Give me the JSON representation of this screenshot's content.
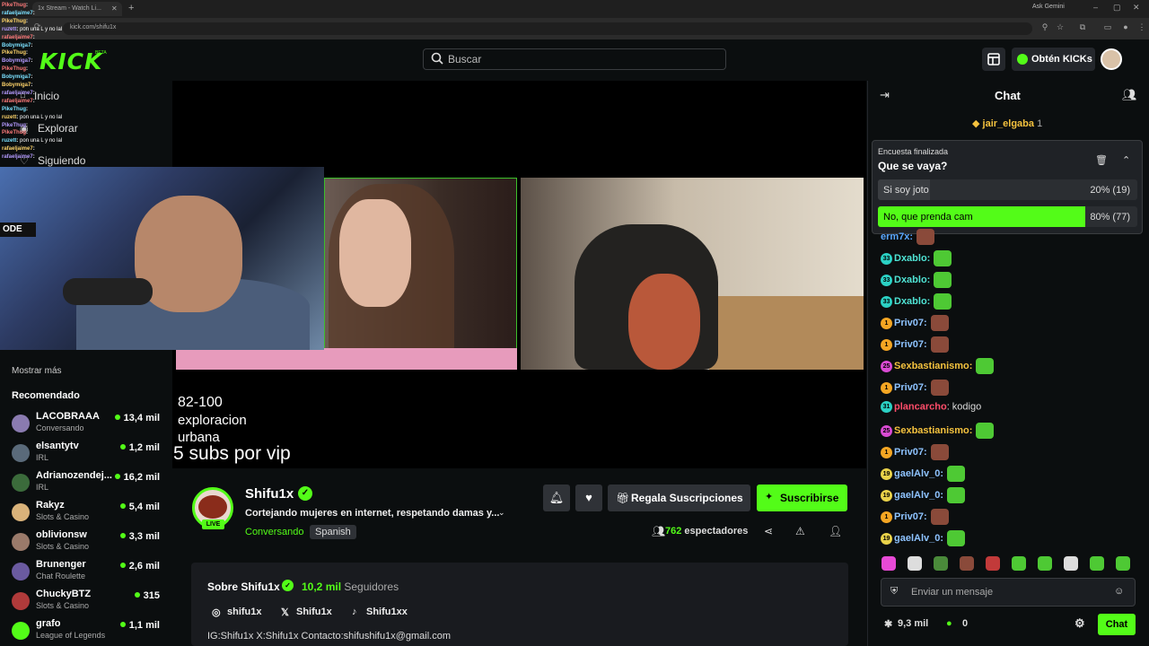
{
  "browser": {
    "tab_title": "1x Stream - Watch Li...",
    "url": "kick.com/shifu1x",
    "gemini_label": "Ask Gemini"
  },
  "header": {
    "logo": "KICK",
    "logo_badge": "BETA",
    "search_placeholder": "Buscar",
    "kicks_label": "Obtén KICKs"
  },
  "sidebar": {
    "nav": [
      {
        "label": "Inicio",
        "icon": "home-icon"
      },
      {
        "label": "Explorar",
        "icon": "compass-icon"
      },
      {
        "label": "Siguiendo",
        "icon": "heart-icon"
      }
    ],
    "show_more": "Mostrar más",
    "recommended_title": "Recomendado",
    "recommended": [
      {
        "name": "LACOBRAAA",
        "category": "Conversando",
        "viewers": "13,4 mil",
        "color": "#8a7bb0"
      },
      {
        "name": "elsantytv",
        "category": "IRL",
        "viewers": "1,2 mil",
        "color": "#5a6a7a"
      },
      {
        "name": "Adrianozendej...",
        "category": "IRL",
        "viewers": "16,2 mil",
        "color": "#3b6b3b"
      },
      {
        "name": "Rakyz",
        "category": "Slots & Casino",
        "viewers": "5,4 mil",
        "color": "#d9b27a"
      },
      {
        "name": "oblivionsw",
        "category": "Slots & Casino",
        "viewers": "3,3 mil",
        "color": "#9a7a6a"
      },
      {
        "name": "Brunenger",
        "category": "Chat Roulette",
        "viewers": "2,6 mil",
        "color": "#6a5aa0"
      },
      {
        "name": "ChuckyBTZ",
        "category": "Slots & Casino",
        "viewers": "315",
        "color": "#b03a3a"
      },
      {
        "name": "grafo",
        "category": "League of Legends",
        "viewers": "1,1 mil",
        "color": "#53fc18"
      }
    ]
  },
  "overlay_chat": [
    {
      "user": "PikeThug",
      "msg": ""
    },
    {
      "user": "rafaeljaime7",
      "msg": ""
    },
    {
      "user": "PikeThug",
      "msg": ""
    },
    {
      "user": "ruzett",
      "msg": "pon una L y no lal"
    },
    {
      "user": "rafaeljaime7",
      "msg": ""
    },
    {
      "user": "Bobymiga7",
      "msg": ""
    },
    {
      "user": "PikeThug",
      "msg": ""
    },
    {
      "user": "Bobymiga7",
      "msg": ""
    },
    {
      "user": "PikeThug",
      "msg": ""
    },
    {
      "user": "Bobymiga7",
      "msg": ""
    },
    {
      "user": "Bobymiga7",
      "msg": ""
    },
    {
      "user": "rafaeljaime7",
      "msg": ""
    },
    {
      "user": "rafaeljaime7",
      "msg": ""
    },
    {
      "user": "PikeThug",
      "msg": ""
    },
    {
      "user": "ruzett",
      "msg": "pon una L y no lal"
    },
    {
      "user": "PikeThug",
      "msg": ""
    },
    {
      "user": "PikeThug",
      "msg": ""
    },
    {
      "user": "ruzett",
      "msg": "pon una L y no lal"
    },
    {
      "user": "rafaeljaime7",
      "msg": ""
    },
    {
      "user": "rafaeljaime7",
      "msg": ""
    }
  ],
  "video": {
    "overlay_lines": [
      "82-100",
      "exploracion",
      "urbana"
    ],
    "overlay_big": "5 subs por vip",
    "cam_label": "ODE"
  },
  "channel": {
    "name": "Shifu1x",
    "live_badge": "LIVE",
    "title": "Cortejando mujeres en internet, respetando damas y...",
    "category": "Conversando",
    "language": "Spanish",
    "gift_label": "Regala Suscripciones",
    "subscribe_label": "Suscribirse",
    "viewers_count": "762",
    "viewers_label": "espectadores"
  },
  "about": {
    "title": "Sobre Shifu1x",
    "followers": "10,2 mil",
    "followers_label": "Seguidores",
    "socials": [
      {
        "name": "shifu1x",
        "icon": "instagram-icon"
      },
      {
        "name": "Shifu1x",
        "icon": "x-icon"
      },
      {
        "name": "Shifu1xx",
        "icon": "tiktok-icon"
      }
    ],
    "bio": "IG:Shifu1x X:Shifu1x Contacto:shifushifu1x@gmail.com"
  },
  "chat": {
    "title": "Chat",
    "pinned_user": "jair_elgaba",
    "pinned_count": "1",
    "poll": {
      "status": "Encuesta finalizada",
      "question": "Que se vaya?",
      "options": [
        {
          "label": "Si soy joto",
          "pct_label": "20% (19)",
          "pct": 20,
          "winner": false
        },
        {
          "label": "No, que prenda cam",
          "pct_label": "80% (77)",
          "pct": 80,
          "winner": true
        }
      ]
    },
    "messages": [
      {
        "badge": "",
        "badge_color": "",
        "user": "erm7x:",
        "color": "#5aa7ff",
        "text": "",
        "emote": "#8a4a3a"
      },
      {
        "badge": "33",
        "badge_color": "#2bd1c4",
        "user": "Dxablo:",
        "color": "#4fe3d4",
        "text": "",
        "emote": "#4ec934"
      },
      {
        "badge": "33",
        "badge_color": "#2bd1c4",
        "user": "Dxablo:",
        "color": "#4fe3d4",
        "text": "",
        "emote": "#4ec934"
      },
      {
        "badge": "33",
        "badge_color": "#2bd1c4",
        "user": "Dxablo:",
        "color": "#4fe3d4",
        "text": "",
        "emote": "#4ec934"
      },
      {
        "badge": "1",
        "badge_color": "#f5a623",
        "user": "Priv07:",
        "color": "#8ec3ff",
        "text": "",
        "emote": "#8a4a3a"
      },
      {
        "badge": "1",
        "badge_color": "#f5a623",
        "user": "Priv07:",
        "color": "#8ec3ff",
        "text": "",
        "emote": "#8a4a3a"
      },
      {
        "badge": "25",
        "badge_color": "#d94bd3",
        "user": "Sexbastianismo:",
        "color": "#f5c23e",
        "text": "",
        "emote": "#4ec934"
      },
      {
        "badge": "1",
        "badge_color": "#f5a623",
        "user": "Priv07:",
        "color": "#8ec3ff",
        "text": "",
        "emote": "#8a4a3a"
      },
      {
        "badge": "31",
        "badge_color": "#2bd1c4",
        "user": "plancarcho",
        "color": "#ff4d6a",
        "text": ": kodigo",
        "emote": ""
      },
      {
        "badge": "25",
        "badge_color": "#d94bd3",
        "user": "Sexbastianismo:",
        "color": "#f5c23e",
        "text": "",
        "emote": "#4ec934"
      },
      {
        "badge": "1",
        "badge_color": "#f5a623",
        "user": "Priv07:",
        "color": "#8ec3ff",
        "text": "",
        "emote": "#8a4a3a"
      },
      {
        "badge": "19",
        "badge_color": "#e9d24a",
        "user": "gaelAlv_0:",
        "color": "#8ec3ff",
        "text": "",
        "emote": "#4ec934"
      },
      {
        "badge": "19",
        "badge_color": "#e9d24a",
        "user": "gaelAlv_0:",
        "color": "#8ec3ff",
        "text": "",
        "emote": "#4ec934"
      },
      {
        "badge": "1",
        "badge_color": "#f5a623",
        "user": "Priv07:",
        "color": "#8ec3ff",
        "text": "",
        "emote": "#8a4a3a"
      },
      {
        "badge": "19",
        "badge_color": "#e9d24a",
        "user": "gaelAlv_0:",
        "color": "#8ec3ff",
        "text": "",
        "emote": "#4ec934"
      }
    ],
    "emote_colors": [
      "#e84ad6",
      "#ddd",
      "#4a8a3a",
      "#8a4a3a",
      "#c23a3a",
      "#4ec934",
      "#4ec934",
      "#ddd",
      "#4ec934",
      "#4ec934"
    ],
    "input_placeholder": "Enviar un mensaje",
    "footer_count1": "9,3 mil",
    "footer_count2": "0",
    "send_label": "Chat"
  },
  "colors": {
    "accent": "#53fc18",
    "bg": "#0b0e0f",
    "panel": "#191b1f"
  }
}
